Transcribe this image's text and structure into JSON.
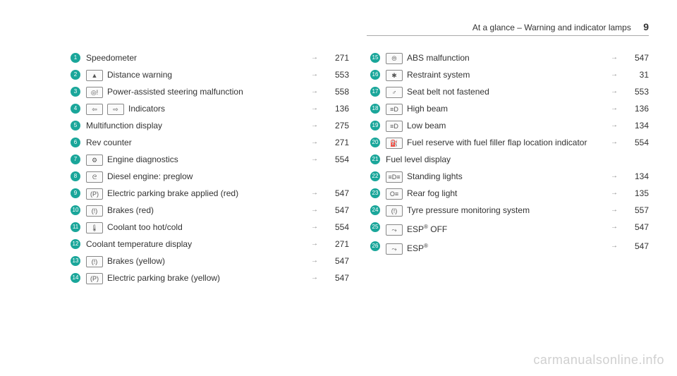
{
  "header": {
    "section": "At a glance – Warning and indicator lamps",
    "page_label": "9"
  },
  "left": [
    {
      "n": "1",
      "icons": [],
      "label": "Speedometer",
      "page": "271"
    },
    {
      "n": "2",
      "icons": [
        "distance-warning-icon"
      ],
      "label": "Distance warning",
      "page": "553"
    },
    {
      "n": "3",
      "icons": [
        "steering-icon"
      ],
      "label": "Power-assisted steering malfunction",
      "page": "558"
    },
    {
      "n": "4",
      "icons": [
        "indicator-left-icon",
        "indicator-right-icon"
      ],
      "label": "Indicators",
      "page": "136"
    },
    {
      "n": "5",
      "icons": [],
      "label": "Multifunction display",
      "page": "275"
    },
    {
      "n": "6",
      "icons": [],
      "label": "Rev counter",
      "page": "271"
    },
    {
      "n": "7",
      "icons": [
        "engine-icon"
      ],
      "label": "Engine diagnostics",
      "page": "554"
    },
    {
      "n": "8",
      "icons": [
        "preglow-icon"
      ],
      "label": "Diesel engine: preglow",
      "page": ""
    },
    {
      "n": "9",
      "icons": [
        "parking-brake-red-icon"
      ],
      "label": "Electric parking brake applied (red)",
      "page": "547"
    },
    {
      "n": "10",
      "icons": [
        "brakes-red-icon"
      ],
      "label": "Brakes (red)",
      "page": "547"
    },
    {
      "n": "11",
      "icons": [
        "coolant-icon"
      ],
      "label": "Coolant too hot/cold",
      "page": "554"
    },
    {
      "n": "12",
      "icons": [],
      "label": "Coolant temperature display",
      "page": "271"
    },
    {
      "n": "13",
      "icons": [
        "brakes-yellow-icon"
      ],
      "label": "Brakes (yellow)",
      "page": "547"
    },
    {
      "n": "14",
      "icons": [
        "parking-brake-yellow-icon"
      ],
      "label": "Electric parking brake (yellow)",
      "page": "547"
    }
  ],
  "right": [
    {
      "n": "15",
      "icons": [
        "abs-icon"
      ],
      "label": "ABS malfunction",
      "page": "547"
    },
    {
      "n": "16",
      "icons": [
        "restraint-icon"
      ],
      "label": "Restraint system",
      "page": "31"
    },
    {
      "n": "17",
      "icons": [
        "seatbelt-icon"
      ],
      "label": "Seat belt not fastened",
      "page": "553"
    },
    {
      "n": "18",
      "icons": [
        "highbeam-icon"
      ],
      "label": "High beam",
      "page": "136"
    },
    {
      "n": "19",
      "icons": [
        "lowbeam-icon"
      ],
      "label": "Low beam",
      "page": "134"
    },
    {
      "n": "20",
      "icons": [
        "fuel-icon"
      ],
      "label": "Fuel reserve with fuel filler flap location indicator",
      "page": "554"
    },
    {
      "n": "21",
      "icons": [],
      "label": "Fuel level display",
      "page": ""
    },
    {
      "n": "22",
      "icons": [
        "standing-lights-icon"
      ],
      "label": "Standing lights",
      "page": "134"
    },
    {
      "n": "23",
      "icons": [
        "rear-fog-icon"
      ],
      "label": "Rear fog light",
      "page": "135"
    },
    {
      "n": "24",
      "icons": [
        "tyre-pressure-icon"
      ],
      "label": "Tyre pressure monitoring system",
      "page": "557"
    },
    {
      "n": "25",
      "icons": [
        "esp-off-icon"
      ],
      "label": "ESP® OFF",
      "page": "547"
    },
    {
      "n": "26",
      "icons": [
        "esp-icon"
      ],
      "label": "ESP®",
      "page": "547"
    }
  ],
  "icon_glyphs": {
    "distance-warning-icon": "▲",
    "steering-icon": "◎!",
    "indicator-left-icon": "⇦",
    "indicator-right-icon": "⇨",
    "engine-icon": "⚙",
    "preglow-icon": "ᘓ",
    "parking-brake-red-icon": "(P)",
    "brakes-red-icon": "(!)",
    "coolant-icon": "🌡",
    "brakes-yellow-icon": "(!)",
    "parking-brake-yellow-icon": "(P)",
    "abs-icon": "⦾",
    "restraint-icon": "✱",
    "seatbelt-icon": "♂",
    "highbeam-icon": "≡D",
    "lowbeam-icon": "≡D",
    "fuel-icon": "⛽",
    "standing-lights-icon": "≡D≡",
    "rear-fog-icon": "O≡",
    "tyre-pressure-icon": "(!)",
    "esp-off-icon": "⤳",
    "esp-icon": "⤳"
  },
  "arrow": "→",
  "watermark": "carmanualsonline.info"
}
